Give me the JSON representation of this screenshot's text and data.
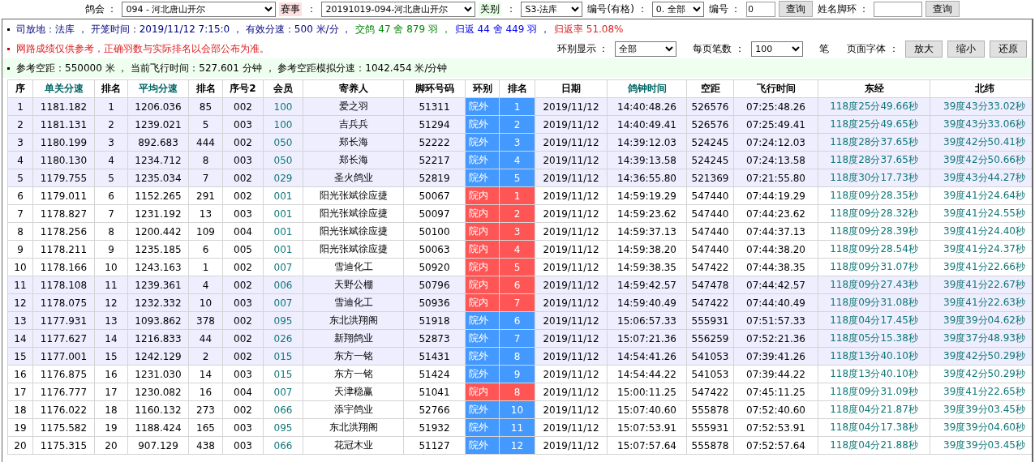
{
  "filter_bar": {
    "items": [
      {
        "kind": "label",
        "text": "鸽会 ："
      },
      {
        "kind": "select",
        "value": "094 - 河北唐山开尔"
      },
      {
        "kind": "label",
        "text": "赛事"
      },
      {
        "kind": "label",
        "text": "："
      },
      {
        "kind": "select",
        "value": "20191019-094-河北唐山开尔"
      },
      {
        "kind": "label",
        "text": "关别"
      },
      {
        "kind": "label",
        "text": "："
      },
      {
        "kind": "select",
        "value": "S3-法库"
      },
      {
        "kind": "label",
        "text": "编号(有格) ："
      },
      {
        "kind": "select",
        "value": "0. 全部"
      },
      {
        "kind": "label",
        "text": "编号 ："
      },
      {
        "kind": "input",
        "value": "0"
      },
      {
        "kind": "button",
        "text": "查询"
      },
      {
        "kind": "label",
        "text": "姓名脚环 ："
      },
      {
        "kind": "input",
        "value": ""
      },
      {
        "kind": "button",
        "text": "查询"
      }
    ]
  },
  "info": {
    "line_1": [
      {
        "text": "司放地：法库 ， 开笼时间：2019/11/12 7:15:0 ， 有效分速：500 米/分 ，",
        "color": "#000080"
      },
      {
        "text": "交鸽 47 舍 879 羽 ，",
        "color": "#008800"
      },
      {
        "text": "归返 44 舍 449 羽 ，",
        "color": "#0000ee"
      },
      {
        "text": "归返率 51.08%",
        "color": "#dd2222"
      }
    ],
    "notice": "网路成绩仅供参考，正确羽数与实际排名以会部公布为准。",
    "controls": [
      {
        "kind": "label",
        "text": "环别显示 ："
      },
      {
        "kind": "select",
        "value": "全部"
      },
      {
        "kind": "label",
        "text": "每页笔数 ："
      },
      {
        "kind": "select",
        "value": "100"
      },
      {
        "kind": "label",
        "text": "笔"
      },
      {
        "kind": "label",
        "text": "页面字体 ："
      },
      {
        "kind": "button",
        "text": "放大"
      },
      {
        "kind": "button",
        "text": "缩小"
      },
      {
        "kind": "button",
        "text": "还原"
      }
    ],
    "reference": "参考空距：550000 米 ， 当前飞行时间：527.601 分钟 ， 参考空距模拟分速：1042.454 米/分钟"
  },
  "table": {
    "columns": [
      {
        "label": "序",
        "highlight": false
      },
      {
        "label": "单关分速",
        "highlight": true
      },
      {
        "label": "排名",
        "highlight": false
      },
      {
        "label": "平均分速",
        "highlight": true
      },
      {
        "label": "排名",
        "highlight": false
      },
      {
        "label": "序号2",
        "highlight": false
      },
      {
        "label": "会员",
        "highlight": false
      },
      {
        "label": "寄养人",
        "highlight": false
      },
      {
        "label": "脚环号码",
        "highlight": false
      },
      {
        "label": "环别",
        "highlight": false
      },
      {
        "label": "排名",
        "highlight": false
      },
      {
        "label": "日期",
        "highlight": false
      },
      {
        "label": "鸽钟时间",
        "highlight": true
      },
      {
        "label": "空距",
        "highlight": false
      },
      {
        "label": "飞行时间",
        "highlight": false
      },
      {
        "label": "东经",
        "highlight": false
      },
      {
        "label": "北纬",
        "highlight": false
      }
    ],
    "rows": [
      {
        "shaded": true,
        "color": "#4499ff",
        "cells": [
          "1",
          "1181.182",
          "1",
          "1206.036",
          "85",
          "002",
          "100",
          "爱之羽",
          "51311",
          "院外",
          "1",
          "2019/11/12",
          "14:40:48.26",
          "526576",
          "07:25:48.26",
          "118度25分49.66秒",
          "39度43分33.02秒"
        ]
      },
      {
        "shaded": true,
        "color": "#4499ff",
        "cells": [
          "2",
          "1181.131",
          "2",
          "1239.021",
          "5",
          "003",
          "100",
          "吉兵兵",
          "51294",
          "院外",
          "2",
          "2019/11/12",
          "14:40:49.41",
          "526576",
          "07:25:49.41",
          "118度25分49.65秒",
          "39度43分33.06秒"
        ]
      },
      {
        "shaded": true,
        "color": "#4499ff",
        "cells": [
          "3",
          "1180.199",
          "3",
          "892.683",
          "444",
          "002",
          "050",
          "郑长海",
          "52222",
          "院外",
          "3",
          "2019/11/12",
          "14:39:12.03",
          "524245",
          "07:24:12.03",
          "118度28分37.65秒",
          "39度42分50.41秒"
        ]
      },
      {
        "shaded": true,
        "color": "#4499ff",
        "cells": [
          "4",
          "1180.130",
          "4",
          "1234.712",
          "8",
          "003",
          "050",
          "郑长海",
          "52217",
          "院外",
          "4",
          "2019/11/12",
          "14:39:13.58",
          "524245",
          "07:24:13.58",
          "118度28分37.65秒",
          "39度42分50.66秒"
        ]
      },
      {
        "shaded": true,
        "color": "#4499ff",
        "cells": [
          "5",
          "1179.755",
          "5",
          "1235.034",
          "7",
          "002",
          "029",
          "圣火鸽业",
          "52819",
          "院外",
          "5",
          "2019/11/12",
          "14:36:55.80",
          "521369",
          "07:21:55.80",
          "118度30分17.73秒",
          "39度43分44.27秒"
        ]
      },
      {
        "shaded": false,
        "color": "#ff5555",
        "cells": [
          "6",
          "1179.011",
          "6",
          "1152.265",
          "291",
          "002",
          "001",
          "阳光张斌徐应捷",
          "50067",
          "院内",
          "1",
          "2019/11/12",
          "14:59:19.29",
          "547440",
          "07:44:19.29",
          "118度09分28.35秒",
          "39度41分24.64秒"
        ]
      },
      {
        "shaded": false,
        "color": "#ff5555",
        "cells": [
          "7",
          "1178.827",
          "7",
          "1231.192",
          "13",
          "003",
          "001",
          "阳光张斌徐应捷",
          "50097",
          "院内",
          "2",
          "2019/11/12",
          "14:59:23.62",
          "547440",
          "07:44:23.62",
          "118度09分28.32秒",
          "39度41分24.55秒"
        ]
      },
      {
        "shaded": false,
        "color": "#ff5555",
        "cells": [
          "8",
          "1178.256",
          "8",
          "1200.442",
          "109",
          "004",
          "001",
          "阳光张斌徐应捷",
          "50100",
          "院内",
          "3",
          "2019/11/12",
          "14:59:37.13",
          "547440",
          "07:44:37.13",
          "118度09分28.39秒",
          "39度41分24.40秒"
        ]
      },
      {
        "shaded": false,
        "color": "#ff5555",
        "cells": [
          "9",
          "1178.211",
          "9",
          "1235.185",
          "6",
          "005",
          "001",
          "阳光张斌徐应捷",
          "50063",
          "院内",
          "4",
          "2019/11/12",
          "14:59:38.20",
          "547440",
          "07:44:38.20",
          "118度09分28.54秒",
          "39度41分24.37秒"
        ]
      },
      {
        "shaded": false,
        "color": "#ff5555",
        "cells": [
          "10",
          "1178.166",
          "10",
          "1243.163",
          "1",
          "002",
          "007",
          "雪迪化工",
          "50920",
          "院内",
          "5",
          "2019/11/12",
          "14:59:38.35",
          "547422",
          "07:44:38.35",
          "118度09分31.07秒",
          "39度41分22.66秒"
        ]
      },
      {
        "shaded": true,
        "color": "#ff5555",
        "cells": [
          "11",
          "1178.108",
          "11",
          "1239.361",
          "4",
          "002",
          "006",
          "天野公棚",
          "50796",
          "院内",
          "6",
          "2019/11/12",
          "14:59:42.57",
          "547478",
          "07:44:42.57",
          "118度09分27.43秒",
          "39度41分22.67秒"
        ]
      },
      {
        "shaded": true,
        "color": "#ff5555",
        "cells": [
          "12",
          "1178.075",
          "12",
          "1232.332",
          "10",
          "003",
          "007",
          "雪迪化工",
          "50936",
          "院内",
          "7",
          "2019/11/12",
          "14:59:40.49",
          "547422",
          "07:44:40.49",
          "118度09分31.08秒",
          "39度41分22.63秒"
        ]
      },
      {
        "shaded": true,
        "color": "#4499ff",
        "cells": [
          "13",
          "1177.931",
          "13",
          "1093.862",
          "378",
          "002",
          "095",
          "东北洪翔阁",
          "51918",
          "院外",
          "6",
          "2019/11/12",
          "15:06:57.33",
          "555931",
          "07:51:57.33",
          "118度04分17.45秒",
          "39度39分04.62秒"
        ]
      },
      {
        "shaded": true,
        "color": "#4499ff",
        "cells": [
          "14",
          "1177.627",
          "14",
          "1216.833",
          "44",
          "002",
          "026",
          "新翔鸽业",
          "52873",
          "院外",
          "7",
          "2019/11/12",
          "15:07:21.36",
          "556259",
          "07:52:21.36",
          "118度05分15.38秒",
          "39度37分48.93秒"
        ]
      },
      {
        "shaded": true,
        "color": "#4499ff",
        "cells": [
          "15",
          "1177.001",
          "15",
          "1242.129",
          "2",
          "002",
          "015",
          "东方一铭",
          "51431",
          "院外",
          "8",
          "2019/11/12",
          "14:54:41.26",
          "541053",
          "07:39:41.26",
          "118度13分40.10秒",
          "39度42分50.29秒"
        ]
      },
      {
        "shaded": false,
        "color": "#4499ff",
        "cells": [
          "16",
          "1176.875",
          "16",
          "1231.030",
          "14",
          "003",
          "015",
          "东方一铭",
          "51424",
          "院外",
          "9",
          "2019/11/12",
          "14:54:44.22",
          "541053",
          "07:39:44.22",
          "118度13分40.10秒",
          "39度42分50.29秒"
        ]
      },
      {
        "shaded": false,
        "color": "#ff5555",
        "cells": [
          "17",
          "1176.777",
          "17",
          "1230.082",
          "16",
          "004",
          "007",
          "天津稳赢",
          "51041",
          "院内",
          "8",
          "2019/11/12",
          "15:00:11.25",
          "547422",
          "07:45:11.25",
          "118度09分31.09秒",
          "39度41分22.65秒"
        ]
      },
      {
        "shaded": false,
        "color": "#4499ff",
        "cells": [
          "18",
          "1176.022",
          "18",
          "1160.132",
          "273",
          "002",
          "066",
          "添宇鸽业",
          "52766",
          "院外",
          "10",
          "2019/11/12",
          "15:07:40.60",
          "555878",
          "07:52:40.60",
          "118度04分21.87秒",
          "39度39分03.45秒"
        ]
      },
      {
        "shaded": false,
        "color": "#4499ff",
        "cells": [
          "19",
          "1175.582",
          "19",
          "1188.424",
          "165",
          "003",
          "095",
          "东北洪翔阁",
          "51932",
          "院外",
          "11",
          "2019/11/12",
          "15:07:53.91",
          "555931",
          "07:52:53.91",
          "118度04分17.38秒",
          "39度39分04.60秒"
        ]
      },
      {
        "shaded": false,
        "color": "#4499ff",
        "cells": [
          "20",
          "1175.315",
          "20",
          "907.129",
          "438",
          "003",
          "066",
          "花冠木业",
          "51127",
          "院外",
          "12",
          "2019/11/12",
          "15:07:57.64",
          "555878",
          "07:52:57.64",
          "118度04分21.88秒",
          "39度39分03.45秒"
        ]
      }
    ]
  }
}
